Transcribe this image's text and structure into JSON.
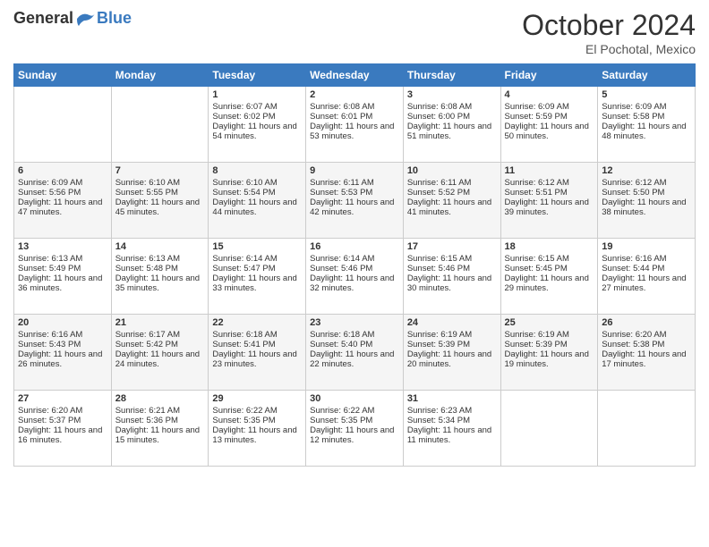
{
  "header": {
    "logo_general": "General",
    "logo_blue": "Blue",
    "month_title": "October 2024",
    "subtitle": "El Pochotal, Mexico"
  },
  "days_of_week": [
    "Sunday",
    "Monday",
    "Tuesday",
    "Wednesday",
    "Thursday",
    "Friday",
    "Saturday"
  ],
  "weeks": [
    [
      {
        "day": "",
        "sunrise": "",
        "sunset": "",
        "daylight": ""
      },
      {
        "day": "",
        "sunrise": "",
        "sunset": "",
        "daylight": ""
      },
      {
        "day": "1",
        "sunrise": "Sunrise: 6:07 AM",
        "sunset": "Sunset: 6:02 PM",
        "daylight": "Daylight: 11 hours and 54 minutes."
      },
      {
        "day": "2",
        "sunrise": "Sunrise: 6:08 AM",
        "sunset": "Sunset: 6:01 PM",
        "daylight": "Daylight: 11 hours and 53 minutes."
      },
      {
        "day": "3",
        "sunrise": "Sunrise: 6:08 AM",
        "sunset": "Sunset: 6:00 PM",
        "daylight": "Daylight: 11 hours and 51 minutes."
      },
      {
        "day": "4",
        "sunrise": "Sunrise: 6:09 AM",
        "sunset": "Sunset: 5:59 PM",
        "daylight": "Daylight: 11 hours and 50 minutes."
      },
      {
        "day": "5",
        "sunrise": "Sunrise: 6:09 AM",
        "sunset": "Sunset: 5:58 PM",
        "daylight": "Daylight: 11 hours and 48 minutes."
      }
    ],
    [
      {
        "day": "6",
        "sunrise": "Sunrise: 6:09 AM",
        "sunset": "Sunset: 5:56 PM",
        "daylight": "Daylight: 11 hours and 47 minutes."
      },
      {
        "day": "7",
        "sunrise": "Sunrise: 6:10 AM",
        "sunset": "Sunset: 5:55 PM",
        "daylight": "Daylight: 11 hours and 45 minutes."
      },
      {
        "day": "8",
        "sunrise": "Sunrise: 6:10 AM",
        "sunset": "Sunset: 5:54 PM",
        "daylight": "Daylight: 11 hours and 44 minutes."
      },
      {
        "day": "9",
        "sunrise": "Sunrise: 6:11 AM",
        "sunset": "Sunset: 5:53 PM",
        "daylight": "Daylight: 11 hours and 42 minutes."
      },
      {
        "day": "10",
        "sunrise": "Sunrise: 6:11 AM",
        "sunset": "Sunset: 5:52 PM",
        "daylight": "Daylight: 11 hours and 41 minutes."
      },
      {
        "day": "11",
        "sunrise": "Sunrise: 6:12 AM",
        "sunset": "Sunset: 5:51 PM",
        "daylight": "Daylight: 11 hours and 39 minutes."
      },
      {
        "day": "12",
        "sunrise": "Sunrise: 6:12 AM",
        "sunset": "Sunset: 5:50 PM",
        "daylight": "Daylight: 11 hours and 38 minutes."
      }
    ],
    [
      {
        "day": "13",
        "sunrise": "Sunrise: 6:13 AM",
        "sunset": "Sunset: 5:49 PM",
        "daylight": "Daylight: 11 hours and 36 minutes."
      },
      {
        "day": "14",
        "sunrise": "Sunrise: 6:13 AM",
        "sunset": "Sunset: 5:48 PM",
        "daylight": "Daylight: 11 hours and 35 minutes."
      },
      {
        "day": "15",
        "sunrise": "Sunrise: 6:14 AM",
        "sunset": "Sunset: 5:47 PM",
        "daylight": "Daylight: 11 hours and 33 minutes."
      },
      {
        "day": "16",
        "sunrise": "Sunrise: 6:14 AM",
        "sunset": "Sunset: 5:46 PM",
        "daylight": "Daylight: 11 hours and 32 minutes."
      },
      {
        "day": "17",
        "sunrise": "Sunrise: 6:15 AM",
        "sunset": "Sunset: 5:46 PM",
        "daylight": "Daylight: 11 hours and 30 minutes."
      },
      {
        "day": "18",
        "sunrise": "Sunrise: 6:15 AM",
        "sunset": "Sunset: 5:45 PM",
        "daylight": "Daylight: 11 hours and 29 minutes."
      },
      {
        "day": "19",
        "sunrise": "Sunrise: 6:16 AM",
        "sunset": "Sunset: 5:44 PM",
        "daylight": "Daylight: 11 hours and 27 minutes."
      }
    ],
    [
      {
        "day": "20",
        "sunrise": "Sunrise: 6:16 AM",
        "sunset": "Sunset: 5:43 PM",
        "daylight": "Daylight: 11 hours and 26 minutes."
      },
      {
        "day": "21",
        "sunrise": "Sunrise: 6:17 AM",
        "sunset": "Sunset: 5:42 PM",
        "daylight": "Daylight: 11 hours and 24 minutes."
      },
      {
        "day": "22",
        "sunrise": "Sunrise: 6:18 AM",
        "sunset": "Sunset: 5:41 PM",
        "daylight": "Daylight: 11 hours and 23 minutes."
      },
      {
        "day": "23",
        "sunrise": "Sunrise: 6:18 AM",
        "sunset": "Sunset: 5:40 PM",
        "daylight": "Daylight: 11 hours and 22 minutes."
      },
      {
        "day": "24",
        "sunrise": "Sunrise: 6:19 AM",
        "sunset": "Sunset: 5:39 PM",
        "daylight": "Daylight: 11 hours and 20 minutes."
      },
      {
        "day": "25",
        "sunrise": "Sunrise: 6:19 AM",
        "sunset": "Sunset: 5:39 PM",
        "daylight": "Daylight: 11 hours and 19 minutes."
      },
      {
        "day": "26",
        "sunrise": "Sunrise: 6:20 AM",
        "sunset": "Sunset: 5:38 PM",
        "daylight": "Daylight: 11 hours and 17 minutes."
      }
    ],
    [
      {
        "day": "27",
        "sunrise": "Sunrise: 6:20 AM",
        "sunset": "Sunset: 5:37 PM",
        "daylight": "Daylight: 11 hours and 16 minutes."
      },
      {
        "day": "28",
        "sunrise": "Sunrise: 6:21 AM",
        "sunset": "Sunset: 5:36 PM",
        "daylight": "Daylight: 11 hours and 15 minutes."
      },
      {
        "day": "29",
        "sunrise": "Sunrise: 6:22 AM",
        "sunset": "Sunset: 5:35 PM",
        "daylight": "Daylight: 11 hours and 13 minutes."
      },
      {
        "day": "30",
        "sunrise": "Sunrise: 6:22 AM",
        "sunset": "Sunset: 5:35 PM",
        "daylight": "Daylight: 11 hours and 12 minutes."
      },
      {
        "day": "31",
        "sunrise": "Sunrise: 6:23 AM",
        "sunset": "Sunset: 5:34 PM",
        "daylight": "Daylight: 11 hours and 11 minutes."
      },
      {
        "day": "",
        "sunrise": "",
        "sunset": "",
        "daylight": ""
      },
      {
        "day": "",
        "sunrise": "",
        "sunset": "",
        "daylight": ""
      }
    ]
  ]
}
